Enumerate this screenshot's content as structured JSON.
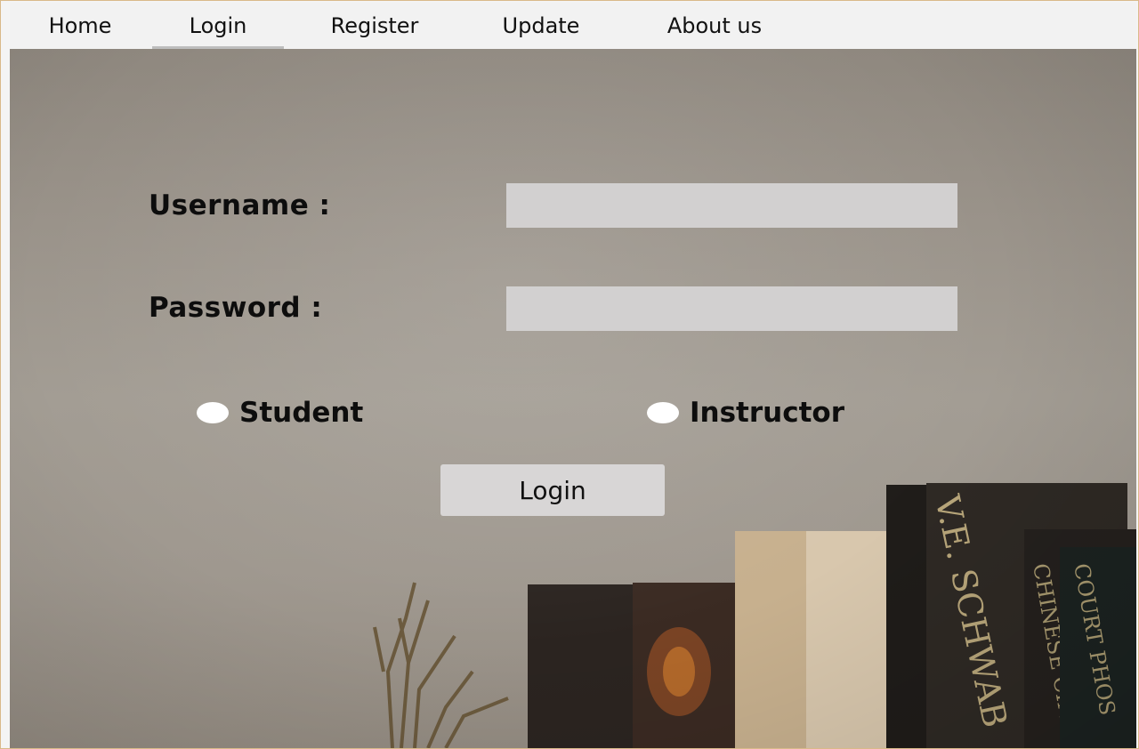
{
  "menu": {
    "tabs": [
      {
        "label": "Home"
      },
      {
        "label": "Login"
      },
      {
        "label": "Register"
      },
      {
        "label": "Update"
      },
      {
        "label": "About us"
      }
    ],
    "active": "Login"
  },
  "form": {
    "username_label": "Username :",
    "password_label": "Password :",
    "username_value": "",
    "password_value": "",
    "role_options": [
      {
        "label": "Student"
      },
      {
        "label": "Instructor"
      }
    ],
    "login_button": "Login"
  },
  "background": {
    "book_spines": [
      "V.E. SCHWAB",
      "CHINESE CIND",
      "COURT PHOS"
    ]
  },
  "colors": {
    "input_bg": "#d2d0d0",
    "button_bg": "#d8d6d6",
    "menubar_bg": "#f2f2f2",
    "wall": "#9f988f"
  }
}
